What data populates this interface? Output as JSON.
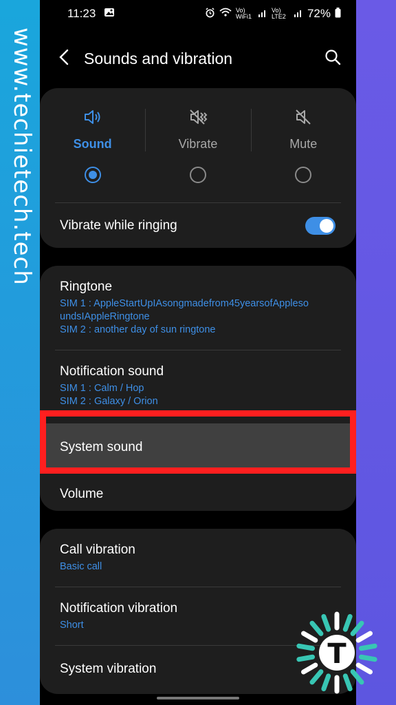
{
  "watermark": "www.techietech.tech",
  "status": {
    "time": "11:23",
    "network1": "Vo) WiFi1",
    "network2": "Vo) LTE2",
    "battery": "72%"
  },
  "appbar": {
    "title": "Sounds and vibration"
  },
  "modes": [
    {
      "label": "Sound",
      "active": true,
      "icon": "speaker-icon"
    },
    {
      "label": "Vibrate",
      "active": false,
      "icon": "vibrate-icon"
    },
    {
      "label": "Mute",
      "active": false,
      "icon": "mute-icon"
    }
  ],
  "vibrate_while_ringing": {
    "label": "Vibrate while ringing",
    "enabled": true
  },
  "ringtone": {
    "title": "Ringtone",
    "sim1": "SIM 1 : AppleStartUpIAsongmadefrom45yearsofApplesoundsIAppleRingtone",
    "sim1_line1": "SIM 1 : AppleStartUpIAsongmadefrom45yearsofAppleso",
    "sim1_line2": "undsIAppleRingtone",
    "sim2": "SIM 2 : another day of sun ringtone"
  },
  "notification_sound": {
    "title": "Notification sound",
    "sim1": "SIM 1 : Calm / Hop",
    "sim2": "SIM 2 : Galaxy / Orion"
  },
  "system_sound": {
    "title": "System sound"
  },
  "volume": {
    "title": "Volume"
  },
  "call_vibration": {
    "title": "Call vibration",
    "value": "Basic call"
  },
  "notification_vibration": {
    "title": "Notification vibration",
    "value": "Short"
  },
  "system_vibration": {
    "title": "System vibration"
  },
  "colors": {
    "accent": "#3e8fe6",
    "highlight": "#ff1f1f",
    "card": "#1e1e1e",
    "logo_teal": "#38c6b4"
  },
  "logo": {
    "letter": "T"
  }
}
